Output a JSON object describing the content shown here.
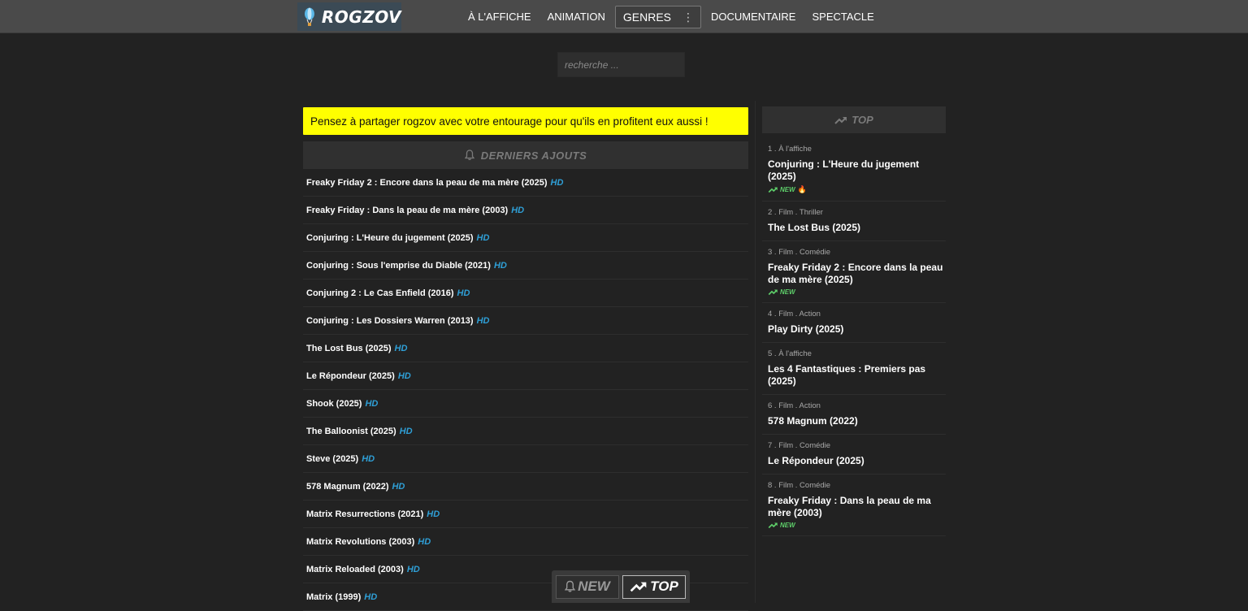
{
  "header": {
    "logo_text": "ROGZOV",
    "nav": [
      {
        "label": "À L'AFFICHE"
      },
      {
        "label": "ANIMATION"
      },
      {
        "label": "GENRES"
      },
      {
        "label": "DOCUMENTAIRE"
      },
      {
        "label": "SPECTACLE"
      }
    ]
  },
  "search": {
    "placeholder": "recherche ..."
  },
  "notice": "Pensez à partager rogzov avec votre entourage pour qu'ils en profitent eux aussi !",
  "latest": {
    "title": "DERNIERS AJOUTS",
    "hd_label": "HD",
    "items": [
      "Freaky Friday 2 : Encore dans la peau de ma mère (2025)",
      "Freaky Friday : Dans la peau de ma mère (2003)",
      "Conjuring : L'Heure du jugement (2025)",
      "Conjuring : Sous l'emprise du Diable (2021)",
      "Conjuring 2 : Le Cas Enfield (2016)",
      "Conjuring : Les Dossiers Warren (2013)",
      "The Lost Bus (2025)",
      "Le Répondeur (2025)",
      "Shook (2025)",
      "The Balloonist (2025)",
      "Steve (2025)",
      "578 Magnum (2022)",
      "Matrix Resurrections (2021)",
      "Matrix Revolutions (2003)",
      "Matrix Reloaded (2003)",
      "Matrix (1999)"
    ]
  },
  "top": {
    "title": "TOP",
    "new_label": "NEW",
    "items": [
      {
        "meta": "1 . À l'affiche",
        "title": "Conjuring : L'Heure du jugement (2025)",
        "new": true,
        "fire": true
      },
      {
        "meta": "2 . Film . Thriller",
        "title": "The Lost Bus (2025)",
        "new": false,
        "fire": false
      },
      {
        "meta": "3 . Film . Comédie",
        "title": "Freaky Friday 2 : Encore dans la peau de ma mère (2025)",
        "new": true,
        "fire": false
      },
      {
        "meta": "4 . Film . Action",
        "title": "Play Dirty (2025)",
        "new": false,
        "fire": false
      },
      {
        "meta": "5 . À l'affiche",
        "title": "Les 4 Fantastiques : Premiers pas (2025)",
        "new": false,
        "fire": false
      },
      {
        "meta": "6 . Film . Action",
        "title": "578 Magnum (2022)",
        "new": false,
        "fire": false
      },
      {
        "meta": "7 . Film . Comédie",
        "title": "Le Répondeur (2025)",
        "new": false,
        "fire": false
      },
      {
        "meta": "8 . Film . Comédie",
        "title": "Freaky Friday : Dans la peau de ma mère (2003)",
        "new": true,
        "fire": false
      }
    ]
  },
  "floating": {
    "new_label": "NEW",
    "top_label": "TOP"
  },
  "colors": {
    "hd": "#2f9fd6",
    "new_badge": "#5ecf6a",
    "notice_bg": "#ffff00",
    "background": "#222222",
    "topbar": "#4a4a4a"
  }
}
